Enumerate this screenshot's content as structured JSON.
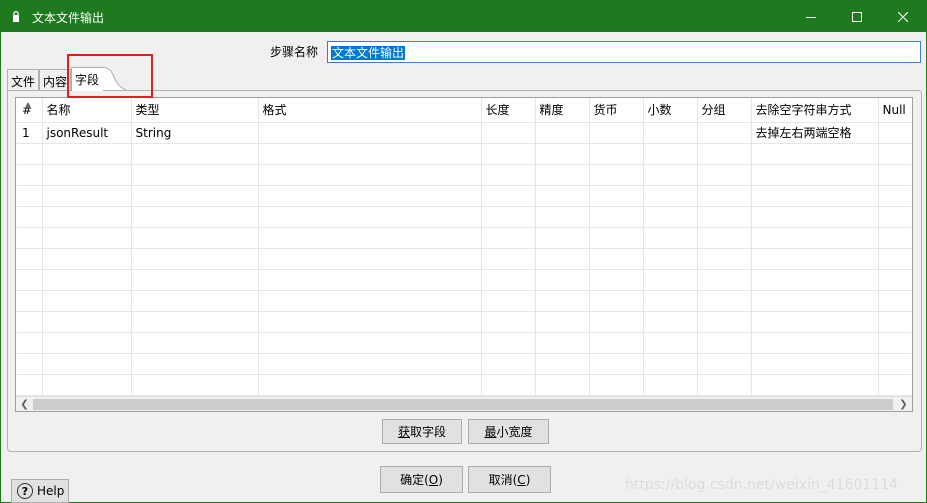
{
  "window": {
    "title": "文本文件输出",
    "accent": "#1f7a1f"
  },
  "step": {
    "label": "步骤名称",
    "value": "文本文件输出"
  },
  "tabs": [
    {
      "label": "文件"
    },
    {
      "label": "内容"
    },
    {
      "label": "字段",
      "active": true
    }
  ],
  "grid": {
    "columns": [
      "#",
      "名称",
      "类型",
      "格式",
      "长度",
      "精度",
      "货币",
      "小数",
      "分组",
      "去除空字符串方式",
      "Null"
    ],
    "rows": [
      [
        "1",
        "jsonResult",
        "String",
        "",
        "",
        "",
        "",
        "",
        "",
        "去掉左右两端空格",
        ""
      ]
    ]
  },
  "buttons": {
    "get_fields": "获取字段",
    "get_fields_mnemonic": "获",
    "min_width": "最小宽度",
    "min_width_mnemonic": "最",
    "ok": "确定(O)",
    "ok_text": "确定(",
    "ok_mnemonic": "O",
    "cancel_text": "取消(",
    "cancel_mnemonic": "C",
    "close_paren": ")",
    "help": "Help"
  },
  "watermark": "https://blog.csdn.net/weixin_41601114",
  "highlight_color": "#e02020"
}
